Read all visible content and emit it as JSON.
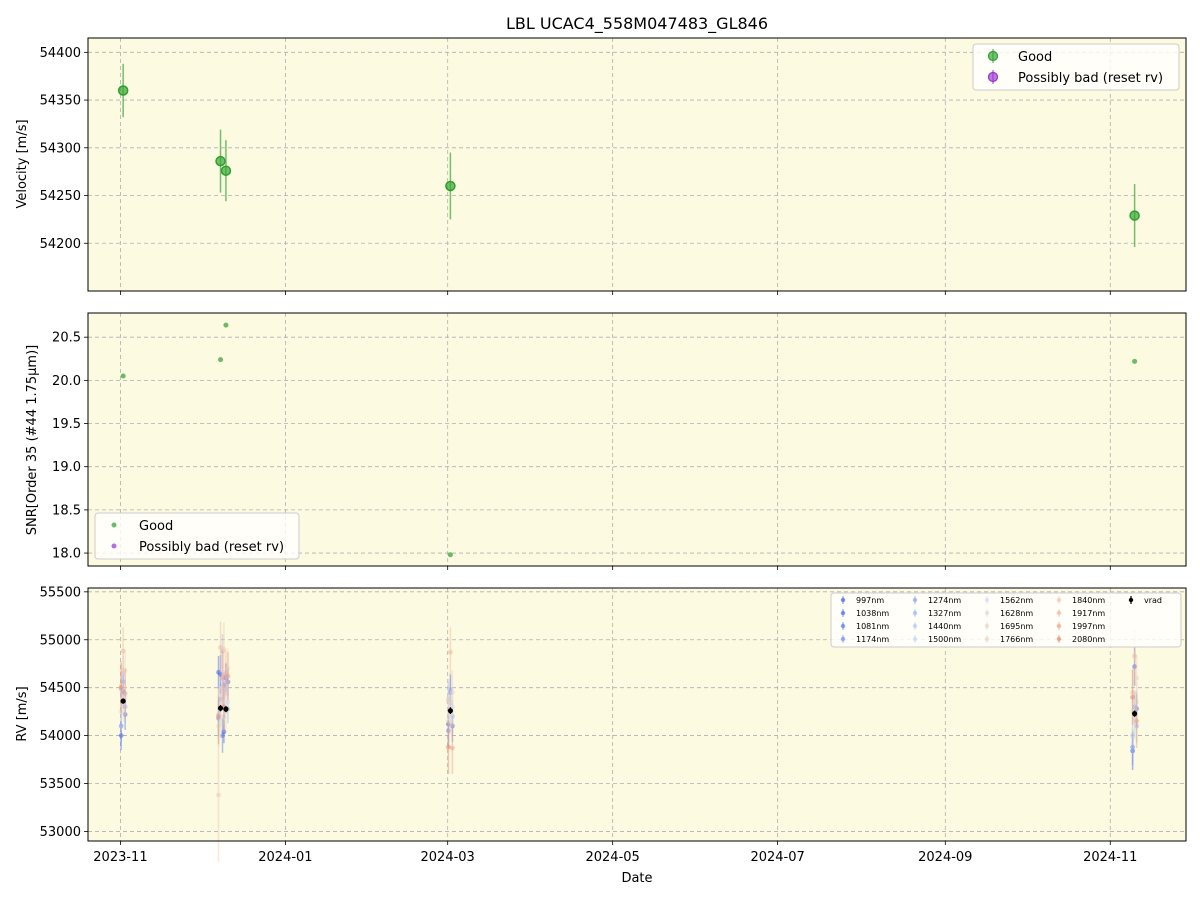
{
  "chart_data": [
    {
      "type": "scatter",
      "panel": "top",
      "title": "LBL UCAC4_558M047483_GL846",
      "ylabel": "Velocity [m/s]",
      "ylim": [
        54150,
        54415
      ],
      "yticks": [
        54200,
        54250,
        54300,
        54350,
        54400
      ],
      "grid": true,
      "background": "#fcfae0",
      "legend": {
        "placement": "top-right",
        "entries": [
          "Good",
          "Possibly bad (reset rv)"
        ]
      },
      "series": [
        {
          "name": "Good",
          "color": "#2ca02c",
          "points": [
            {
              "x": "2023-11-02",
              "y": 54360,
              "err": 28
            },
            {
              "x": "2023-12-08",
              "y": 54286,
              "err": 33
            },
            {
              "x": "2023-12-10",
              "y": 54276,
              "err": 32
            },
            {
              "x": "2024-03-02",
              "y": 54260,
              "err": 35
            },
            {
              "x": "2024-11-10",
              "y": 54229,
              "err": 33
            }
          ]
        },
        {
          "name": "Possibly bad (reset rv)",
          "color": "#9932cc",
          "points": []
        }
      ]
    },
    {
      "type": "scatter",
      "panel": "middle",
      "ylabel": "SNR[Order 35 (#44 1.75μm)]",
      "ylim": [
        17.85,
        20.78
      ],
      "yticks": [
        18.0,
        18.5,
        19.0,
        19.5,
        20.0,
        20.5
      ],
      "grid": true,
      "background": "#fcfae0",
      "legend": {
        "placement": "bottom-left",
        "entries": [
          "Good",
          "Possibly bad (reset rv)"
        ]
      },
      "series": [
        {
          "name": "Good",
          "color": "#2ca02c",
          "points": [
            {
              "x": "2023-11-02",
              "y": 20.05
            },
            {
              "x": "2023-12-08",
              "y": 20.24
            },
            {
              "x": "2023-12-10",
              "y": 20.64
            },
            {
              "x": "2024-03-02",
              "y": 17.98
            },
            {
              "x": "2024-11-10",
              "y": 20.22
            }
          ]
        },
        {
          "name": "Possibly bad (reset rv)",
          "color": "#9932cc",
          "points": []
        }
      ]
    },
    {
      "type": "scatter",
      "panel": "bottom",
      "xlabel": "Date",
      "ylabel": "RV [m/s]",
      "ylim": [
        52900,
        55540
      ],
      "yticks": [
        53000,
        53500,
        54000,
        54500,
        55000,
        55500
      ],
      "xlim": [
        "2023-10-20",
        "2024-11-29"
      ],
      "xticks": [
        "2023-11",
        "2024-01",
        "2024-03",
        "2024-05",
        "2024-07",
        "2024-09",
        "2024-11"
      ],
      "xtick_dates": [
        "2023-11-01",
        "2024-01-01",
        "2024-03-01",
        "2024-05-01",
        "2024-07-01",
        "2024-09-01",
        "2024-11-01"
      ],
      "grid": true,
      "background": "#fcfae0",
      "legend": {
        "placement": "top-right",
        "columns": 5
      },
      "dates": [
        "2023-11-02",
        "2023-12-08",
        "2023-12-10",
        "2024-03-02",
        "2024-11-10"
      ],
      "series": [
        {
          "name": "997nm",
          "color": "#4361ee",
          "values": [
            54000,
            54660,
            54040,
            54120,
            53840
          ],
          "err": [
            150,
            170,
            120,
            180,
            200
          ]
        },
        {
          "name": "1038nm",
          "color": "#4a6bef",
          "values": [
            54460,
            54640,
            54600,
            54450,
            54720
          ],
          "err": [
            180,
            200,
            150,
            190,
            200
          ]
        },
        {
          "name": "1081nm",
          "color": "#5478f0",
          "values": [
            54220,
            54000,
            54560,
            54100,
            54280
          ],
          "err": [
            160,
            180,
            140,
            170,
            180
          ]
        },
        {
          "name": "1174nm",
          "color": "#6f8ff2",
          "values": [
            54100,
            54180,
            54520,
            54050,
            53880
          ],
          "err": [
            170,
            190,
            150,
            180,
            190
          ]
        },
        {
          "name": "1274nm",
          "color": "#86a6f4",
          "values": [
            54560,
            54380,
            54620,
            54480,
            54300
          ],
          "err": [
            150,
            170,
            140,
            160,
            170
          ]
        },
        {
          "name": "1327nm",
          "color": "#9cb8f6",
          "values": [
            54300,
            54880,
            54280,
            54200,
            54100
          ],
          "err": [
            160,
            180,
            150,
            170,
            180
          ]
        },
        {
          "name": "1440nm",
          "color": "#b2c9f7",
          "values": [
            54480,
            54220,
            54200,
            54380,
            54000
          ],
          "err": [
            170,
            190,
            160,
            180,
            190
          ]
        },
        {
          "name": "1500nm",
          "color": "#c4d5f8",
          "values": [
            54650,
            54300,
            54450,
            54280,
            54200
          ],
          "err": [
            180,
            200,
            170,
            190,
            200
          ]
        },
        {
          "name": "1562nm",
          "color": "#d3dcef",
          "values": [
            54400,
            54500,
            54350,
            54300,
            54350
          ],
          "err": [
            190,
            210,
            180,
            200,
            210
          ]
        },
        {
          "name": "1628nm",
          "color": "#dddcd8",
          "values": [
            54250,
            54100,
            54300,
            54150,
            54250
          ],
          "err": [
            200,
            220,
            190,
            210,
            220
          ]
        },
        {
          "name": "1695nm",
          "color": "#e3d8c8",
          "values": [
            54350,
            54200,
            54250,
            54220,
            54180
          ],
          "err": [
            200,
            230,
            190,
            210,
            220
          ]
        },
        {
          "name": "1766nm",
          "color": "#ecd3c2",
          "values": [
            54680,
            54500,
            54700,
            54450,
            54600
          ],
          "err": [
            220,
            240,
            210,
            230,
            240
          ]
        },
        {
          "name": "1840nm",
          "color": "#f3c8b0",
          "values": [
            54520,
            53380,
            54900,
            54350,
            54450
          ],
          "err": [
            230,
            700,
            280,
            240,
            250
          ]
        },
        {
          "name": "1917nm",
          "color": "#f5b69a",
          "values": [
            54880,
            54920,
            54650,
            54870,
            54830
          ],
          "err": [
            250,
            270,
            240,
            260,
            270
          ]
        },
        {
          "name": "1997nm",
          "color": "#f2a086",
          "values": [
            54440,
            54600,
            54620,
            53870,
            54150
          ],
          "err": [
            260,
            280,
            250,
            270,
            280
          ]
        },
        {
          "name": "2080nm",
          "color": "#e98a72",
          "values": [
            54500,
            54200,
            54300,
            53880,
            54400
          ],
          "err": [
            270,
            290,
            260,
            280,
            290
          ]
        },
        {
          "name": "vrad",
          "color": "#000000",
          "values": [
            54360,
            54286,
            54276,
            54260,
            54229
          ],
          "err": [
            28,
            33,
            32,
            35,
            33
          ]
        }
      ]
    }
  ]
}
